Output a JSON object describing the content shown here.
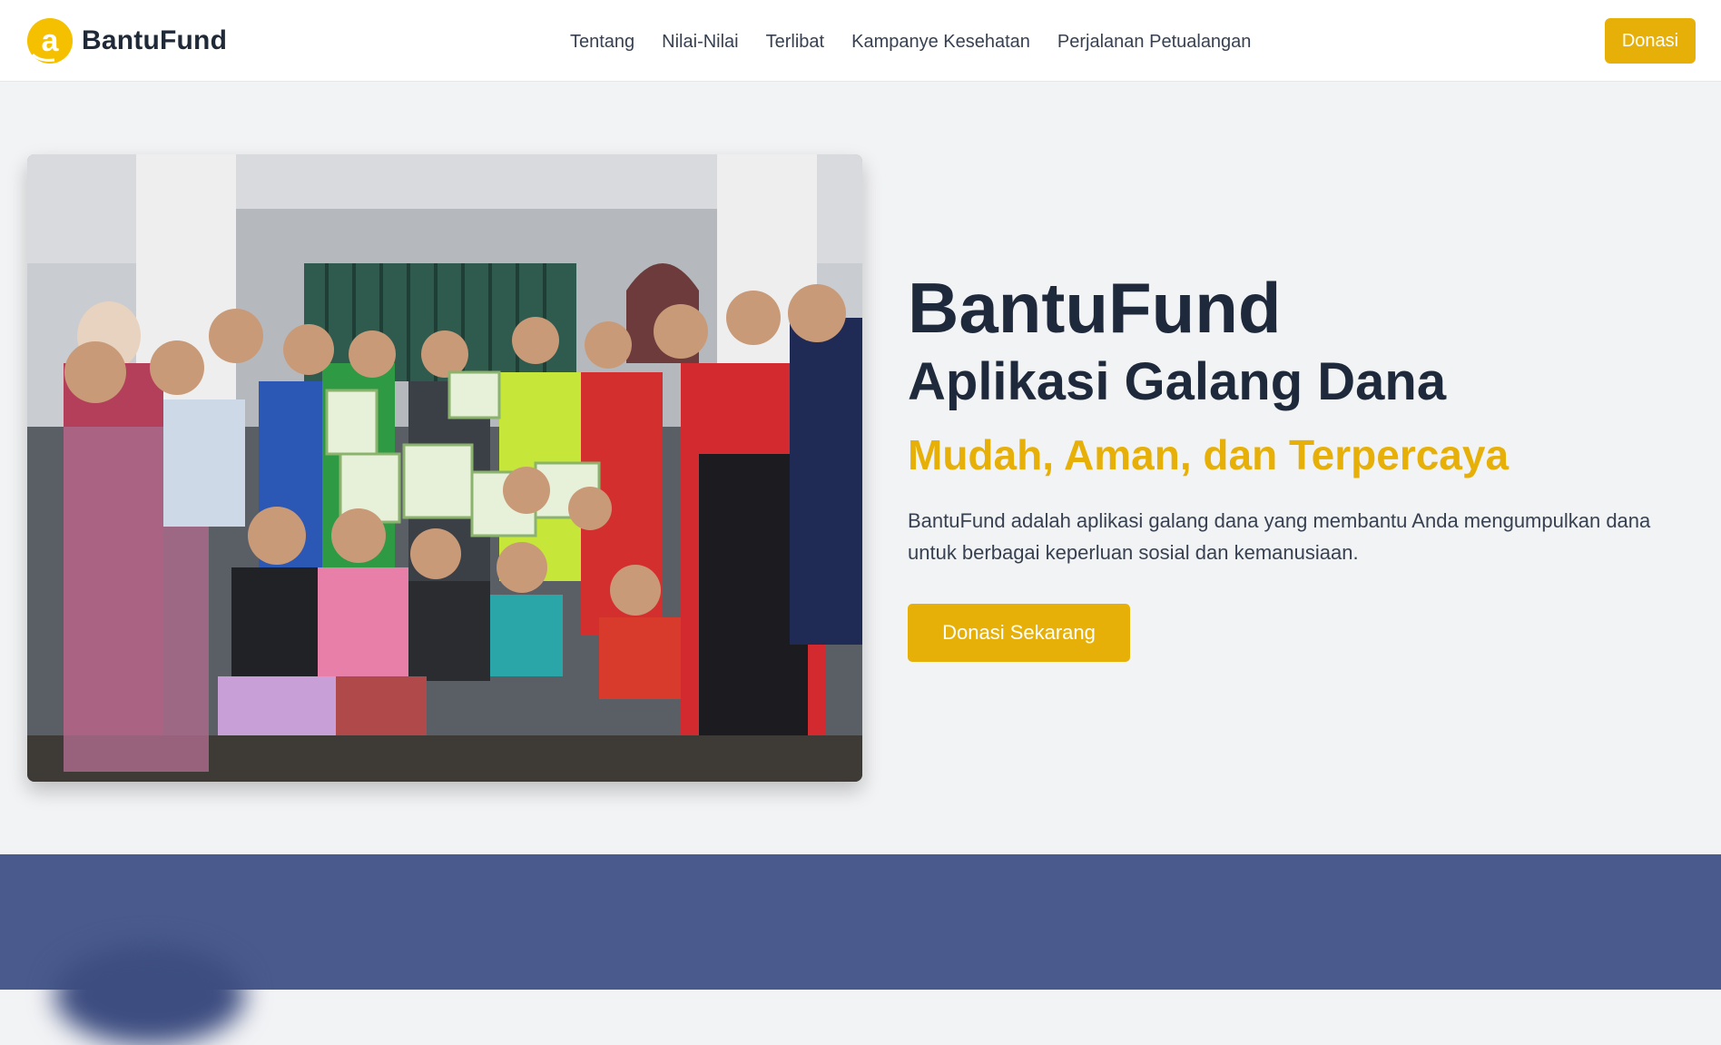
{
  "brand": {
    "name": "BantuFund",
    "logo_icon": "letter-a-logo",
    "color": "#f5c000"
  },
  "nav": {
    "links": [
      {
        "label": "Tentang"
      },
      {
        "label": "Nilai-Nilai"
      },
      {
        "label": "Terlibat"
      },
      {
        "label": "Kampanye Kesehatan"
      },
      {
        "label": "Perjalanan Petualangan"
      }
    ],
    "donate_label": "Donasi"
  },
  "hero": {
    "title": "BantuFund",
    "subtitle": "Aplikasi Galang Dana",
    "tagline": "Mudah, Aman, dan Terpercaya",
    "description": "BantuFund adalah aplikasi galang dana yang membantu Anda mengumpulkan dana untuk berbagai keperluan sosial dan kemanusiaan.",
    "cta_label": "Donasi Sekarang",
    "image_alt": "Group photo of volunteers handing out aid boxes"
  },
  "colors": {
    "accent": "#e7b008",
    "heading": "#1e293b",
    "lower_section": "#4a5a8c",
    "background": "#f2f3f5"
  }
}
